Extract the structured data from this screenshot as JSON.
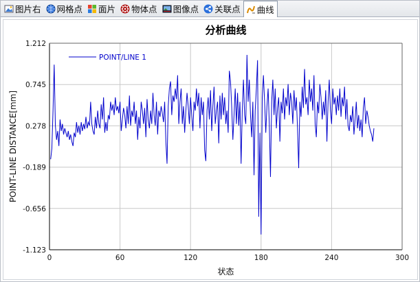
{
  "tabs": [
    {
      "label": "图片右",
      "icon": "image-icon",
      "active": false
    },
    {
      "label": "网格点",
      "icon": "globe-icon",
      "active": false
    },
    {
      "label": "面片",
      "icon": "windows-icon",
      "active": false
    },
    {
      "label": "物体点",
      "icon": "dots-icon",
      "active": false
    },
    {
      "label": "图像点",
      "icon": "picture-icon",
      "active": false
    },
    {
      "label": "关联点",
      "icon": "share-icon",
      "active": false
    },
    {
      "label": "曲线",
      "icon": "curve-icon",
      "active": true
    }
  ],
  "colors": {
    "series": "#0000cc",
    "grid": "#c8c8c8",
    "axis": "#000000"
  },
  "chart_data": {
    "type": "line",
    "title": "分析曲线",
    "xlabel": "状态",
    "ylabel": "POINT-LINE DISTANCE[mm]",
    "xlim": [
      0,
      300
    ],
    "ylim": [
      -1.123,
      1.212
    ],
    "x_ticks": [
      0,
      60,
      120,
      180,
      240,
      300
    ],
    "y_ticks": [
      -1.123,
      -0.656,
      -0.189,
      0.278,
      0.745,
      1.212
    ],
    "y_tick_labels": [
      "-1.123",
      "-0.656",
      "-0.189",
      "0.278",
      "0.745",
      "1.212"
    ],
    "grid": true,
    "legend": "top-left",
    "series": [
      {
        "name": "POINT/LINE 1",
        "color": "#0000cc",
        "x_start": 1,
        "x_step": 1,
        "values": [
          -0.1,
          0.02,
          0.45,
          0.97,
          0.28,
          0.12,
          0.22,
          0.05,
          0.35,
          0.22,
          0.3,
          0.18,
          0.25,
          0.2,
          0.15,
          0.22,
          0.12,
          0.18,
          0.1,
          0.05,
          0.2,
          0.15,
          0.32,
          0.2,
          0.28,
          0.18,
          0.32,
          0.22,
          0.3,
          0.24,
          0.38,
          0.25,
          0.32,
          0.28,
          0.55,
          0.3,
          0.22,
          0.18,
          0.38,
          0.25,
          0.45,
          0.3,
          0.25,
          0.52,
          0.35,
          0.6,
          0.2,
          0.32,
          0.22,
          0.4,
          0.35,
          0.55,
          0.45,
          0.52,
          0.4,
          0.6,
          0.45,
          0.5,
          0.42,
          0.55,
          0.22,
          0.35,
          0.48,
          0.4,
          0.25,
          0.5,
          0.3,
          0.62,
          0.28,
          0.45,
          0.38,
          0.55,
          0.3,
          0.45,
          0.12,
          0.38,
          0.25,
          0.55,
          0.45,
          0.3,
          0.48,
          0.15,
          0.58,
          0.35,
          0.25,
          0.45,
          0.3,
          0.65,
          0.4,
          0.28,
          0.55,
          0.18,
          0.45,
          0.38,
          0.5,
          0.42,
          0.32,
          0.55,
          0.1,
          -0.15,
          0.5,
          0.7,
          0.78,
          0.4,
          0.62,
          0.55,
          0.7,
          0.58,
          0.85,
          0.3,
          0.55,
          0.7,
          0.3,
          0.5,
          0.2,
          0.45,
          0.65,
          0.5,
          0.3,
          0.6,
          0.4,
          0.22,
          0.55,
          0.45,
          0.7,
          0.5,
          0.65,
          0.25,
          0.6,
          0.4,
          0.55,
          0.0,
          -0.12,
          0.45,
          0.6,
          0.35,
          0.68,
          0.22,
          0.5,
          0.72,
          0.3,
          0.45,
          0.55,
          0.08,
          0.62,
          0.35,
          0.65,
          0.4,
          0.6,
          0.3,
          0.45,
          0.2,
          0.9,
          0.78,
          0.5,
          0.12,
          0.4,
          0.7,
          0.3,
          0.65,
          0.28,
          0.55,
          -0.15,
          0.45,
          0.8,
          0.4,
          0.3,
          1.08,
          0.55,
          0.8,
          0.4,
          0.15,
          0.55,
          -0.28,
          0.45,
          0.7,
          1.02,
          -0.75,
          0.2,
          -0.95,
          0.6,
          0.85,
          0.55,
          0.2,
          0.5,
          0.7,
          0.3,
          -0.3,
          0.55,
          0.8,
          0.4,
          0.7,
          0.25,
          0.48,
          0.6,
          0.1,
          0.55,
          0.42,
          0.7,
          0.35,
          0.6,
          0.5,
          0.75,
          0.4,
          0.65,
          0.55,
          0.3,
          0.68,
          0.45,
          0.6,
          0.25,
          -0.2,
          0.55,
          0.38,
          0.72,
          0.48,
          0.92,
          0.52,
          0.6,
          0.4,
          0.8,
          0.55,
          0.7,
          0.45,
          0.85,
          0.3,
          0.15,
          0.55,
          0.42,
          0.75,
          0.6,
          0.35,
          0.55,
          0.4,
          0.68,
          0.1,
          0.55,
          0.8,
          0.45,
          0.3,
          0.7,
          0.52,
          0.6,
          0.4,
          0.62,
          0.45,
          0.7,
          0.38,
          0.6,
          0.5,
          0.72,
          0.35,
          0.58,
          0.28,
          0.22,
          0.4,
          0.32,
          0.5,
          0.18,
          0.35,
          0.55,
          0.25,
          0.4,
          0.22,
          0.35,
          0.15,
          0.48,
          0.6,
          0.3,
          0.45,
          0.38,
          0.28,
          0.22,
          0.18,
          0.1,
          0.25
        ]
      }
    ]
  }
}
